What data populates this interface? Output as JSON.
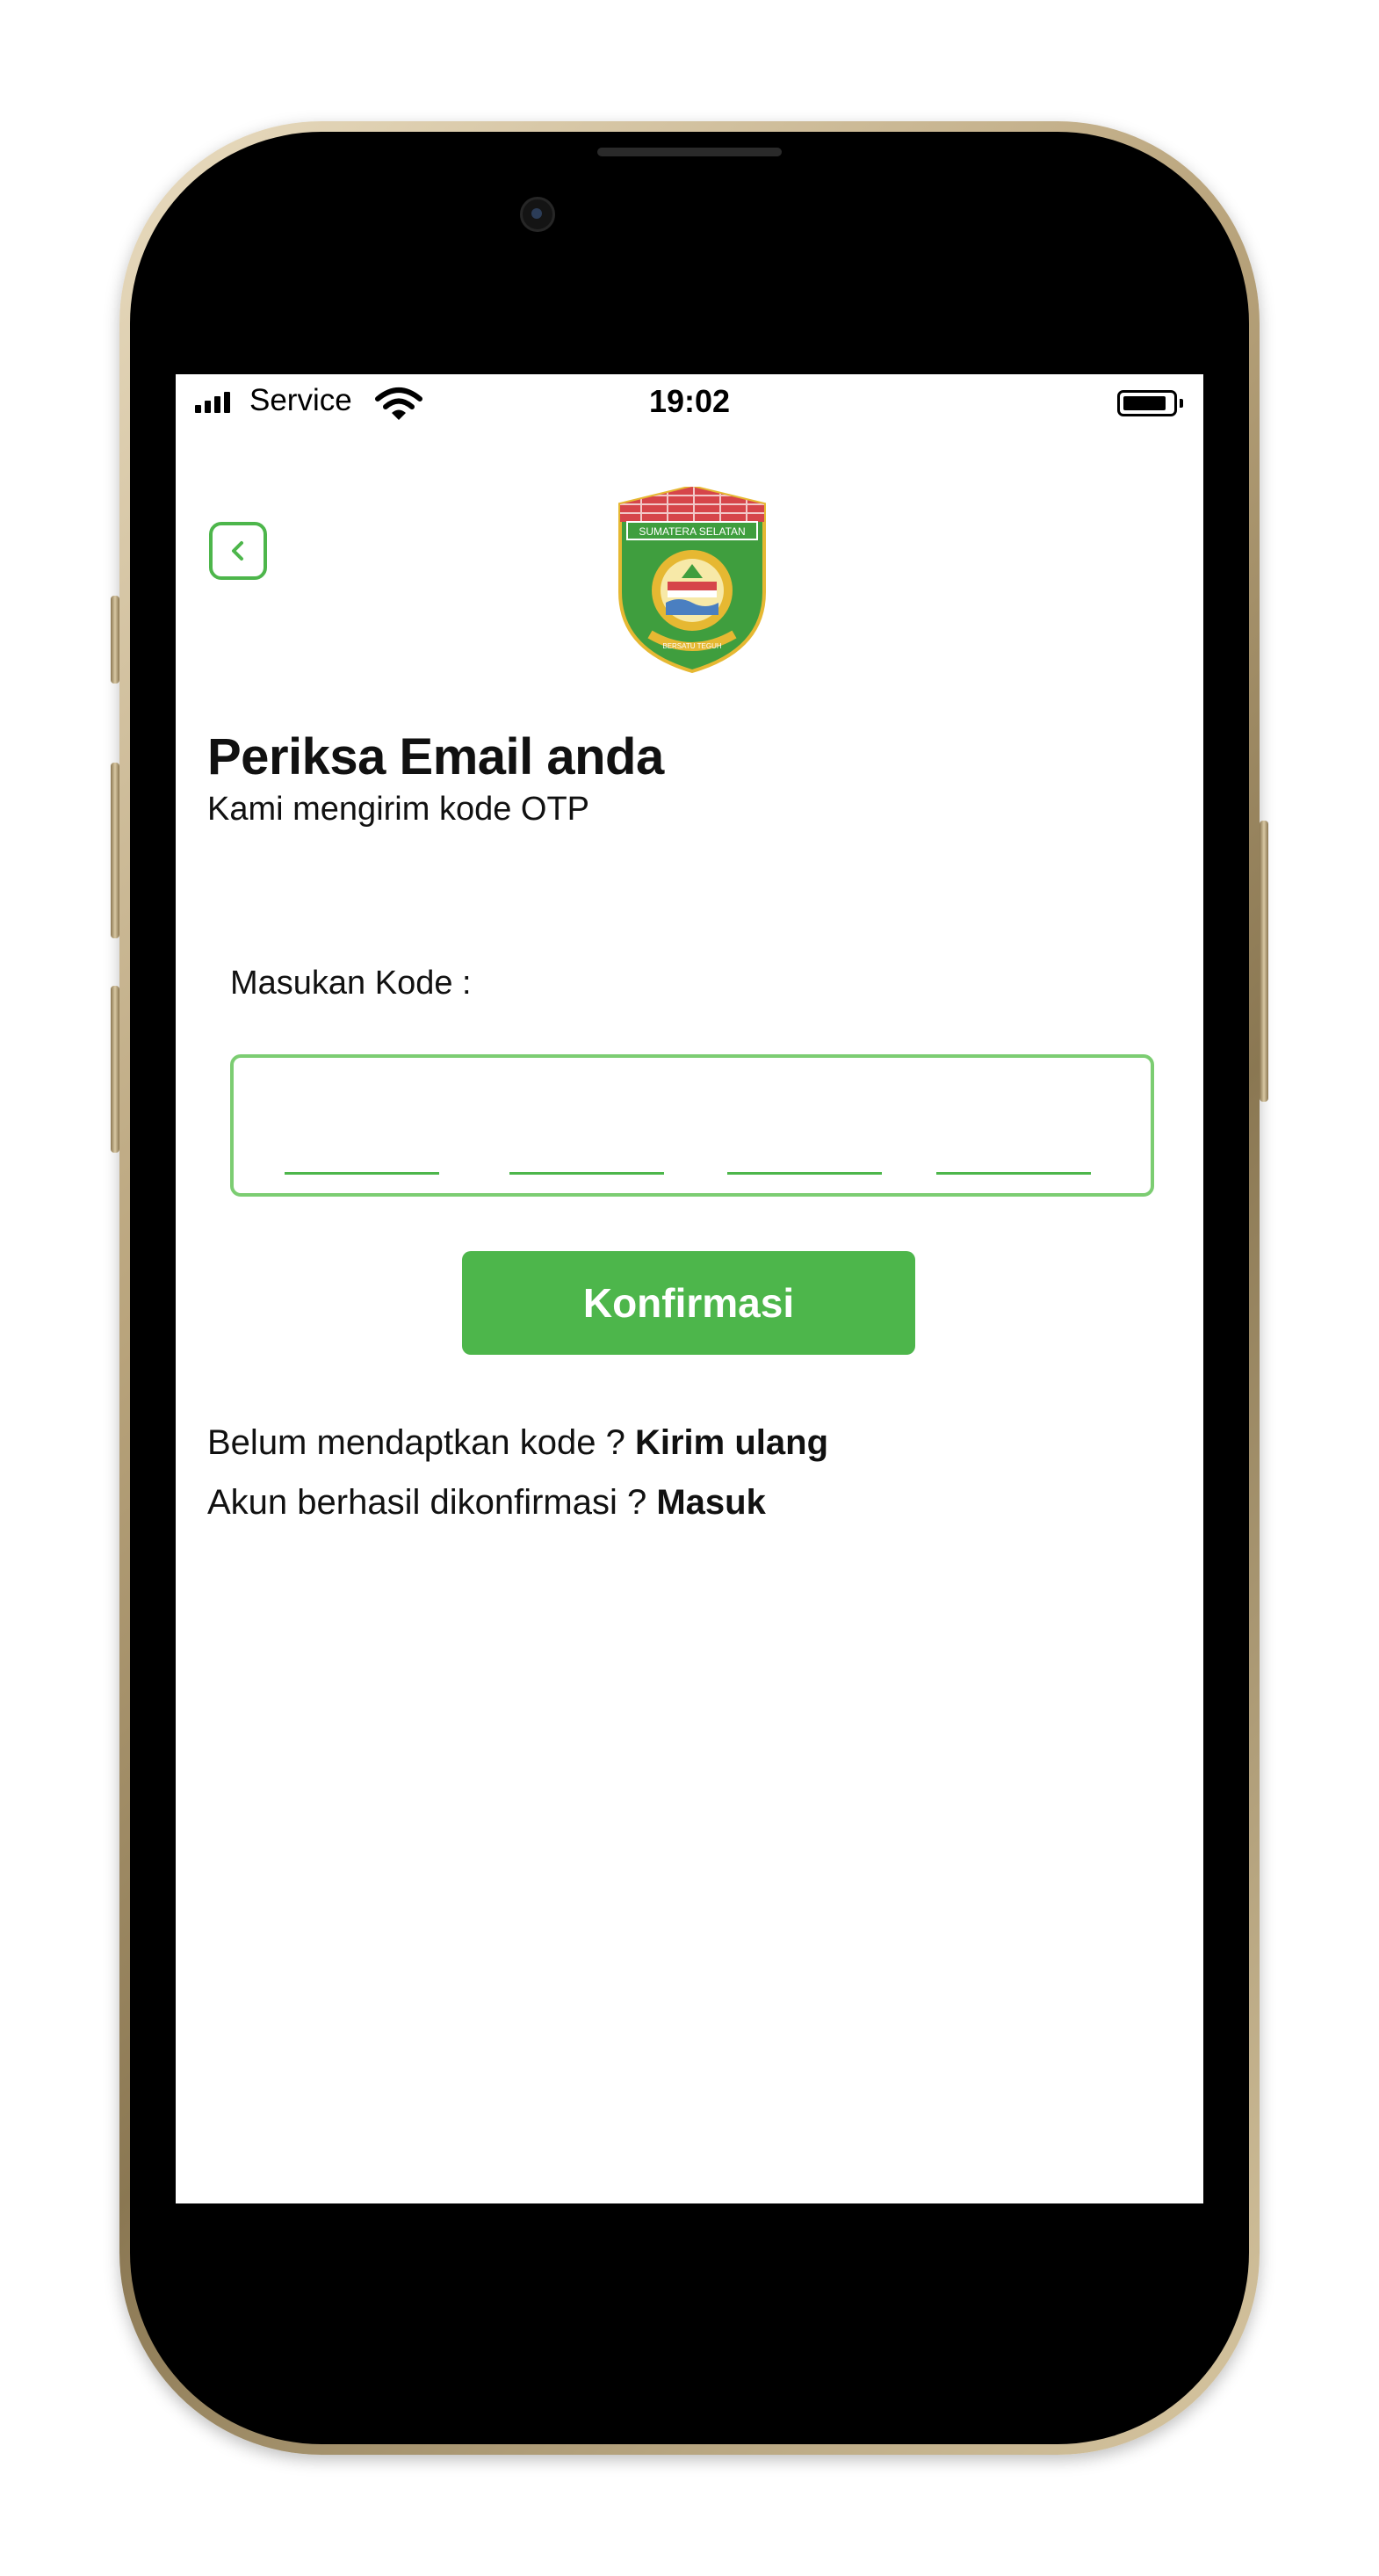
{
  "status_bar": {
    "carrier": "Service",
    "time": "19:02"
  },
  "logo": {
    "banner_text": "SUMATERA SELATAN",
    "motto_text": "BERSATU TEGUH",
    "icon": "provincial-emblem"
  },
  "header": {
    "title": "Periksa Email anda",
    "subtitle": "Kami mengirim kode OTP"
  },
  "otp": {
    "label": "Masukan Kode :",
    "digits": [
      "",
      "",
      "",
      ""
    ]
  },
  "confirm_button": {
    "label": "Konfirmasi"
  },
  "resend": {
    "prompt": "Belum mendaptkan kode ?",
    "link": "Kirim ulang"
  },
  "login": {
    "prompt": "Akun berhasil dikonfirmasi ?",
    "link": "Masuk"
  },
  "colors": {
    "accent": "#4db64b",
    "border": "#7ccd72",
    "text": "#111111"
  }
}
